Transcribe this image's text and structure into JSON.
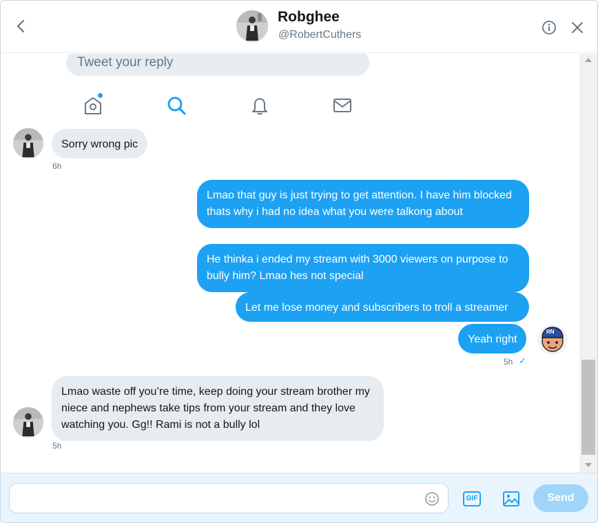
{
  "header": {
    "name": "Robghee",
    "handle": "@RobertCuthers"
  },
  "reply": {
    "placeholder": "Tweet your reply"
  },
  "nav": {
    "icons": [
      "home-icon",
      "search-icon",
      "notifications-icon",
      "messages-icon"
    ]
  },
  "messages": [
    {
      "direction": "in",
      "text": "Sorry wrong pic",
      "time": "6h"
    },
    {
      "direction": "out",
      "text": "Lmao that guy is just trying to get attention. I have him blocked thats why i had no idea what you were talkong about"
    },
    {
      "direction": "out",
      "text": "He thinka i ended my stream with 3000 viewers on purpose to bully him? Lmao hes not special"
    },
    {
      "direction": "out",
      "text": "Let me lose money and subscribers to troll a streamer"
    },
    {
      "direction": "out",
      "text": "Yeah right",
      "time": "5h",
      "status": "✓"
    },
    {
      "direction": "in",
      "text": "Lmao waste off you’re time, keep doing your stream brother my niece and nephews take tips from your stream and they love watching you. Gg!! Rami is not a bully lol",
      "time": "5h"
    }
  ],
  "my_avatar": {
    "badge": "RN"
  },
  "composer": {
    "input_value": "",
    "gif_label": "GIF",
    "send_label": "Send"
  },
  "colors": {
    "accent": "#1da1f2",
    "incoming_bubble": "#e6ecf0",
    "send_disabled": "#9fd5f8"
  }
}
